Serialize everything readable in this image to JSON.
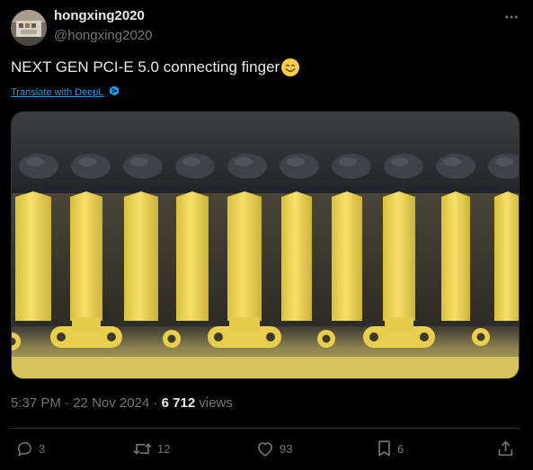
{
  "author": {
    "display_name": "hongxing2020",
    "handle": "@hongxing2020"
  },
  "header": {
    "more_icon": "more-horizontal-icon"
  },
  "tweet": {
    "text": "NEXT GEN PCI-E 5.0 connecting finger",
    "emoji": "smiling-face-with-tear",
    "translate_label": "Translate with DeepL",
    "media_description_icon": "pcie-connector-photo"
  },
  "meta": {
    "time": "5:37 PM",
    "separator1": " · ",
    "date": "22 Nov 2024",
    "separator2": " · ",
    "views_count": "6 712",
    "views_label": " views"
  },
  "actions": {
    "replies": "3",
    "reposts": "12",
    "likes": "93",
    "bookmarks": "6"
  },
  "colors": {
    "background": "#000000",
    "text": "#e7e9ea",
    "muted": "#71767b",
    "link": "#1d9bf0",
    "divider": "#2f3336"
  }
}
